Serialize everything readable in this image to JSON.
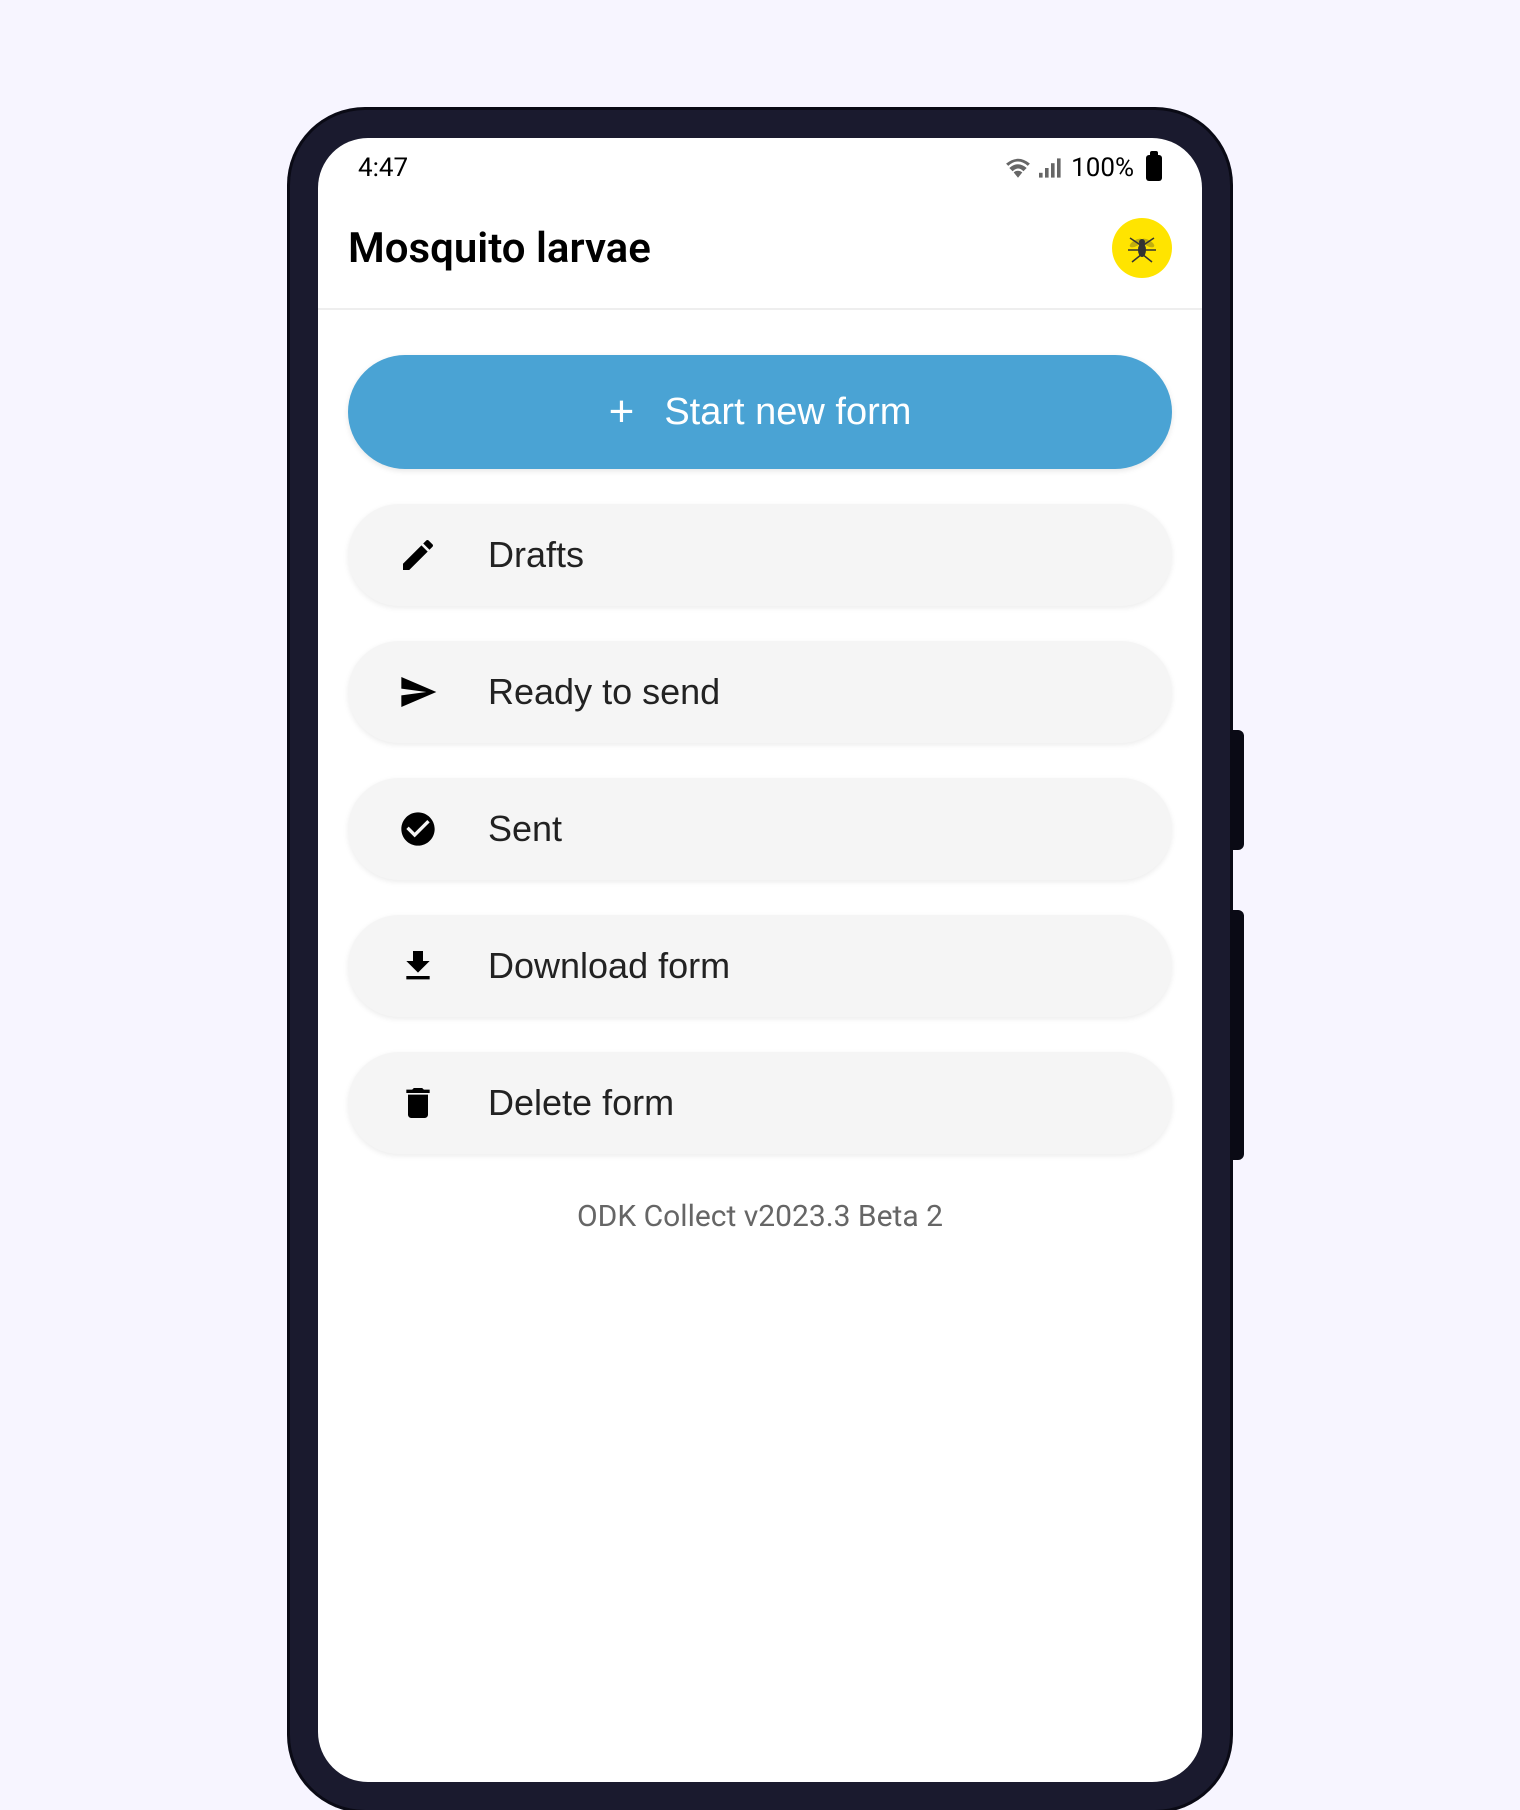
{
  "status_bar": {
    "time": "4:47",
    "battery_percent": "100%"
  },
  "header": {
    "title": "Mosquito larvae",
    "profile_icon": "mosquito-icon"
  },
  "primary_action": {
    "label": "Start new form"
  },
  "menu": {
    "items": [
      {
        "icon": "edit-icon",
        "label": "Drafts"
      },
      {
        "icon": "send-icon",
        "label": "Ready to send"
      },
      {
        "icon": "check-circle-icon",
        "label": "Sent"
      },
      {
        "icon": "download-icon",
        "label": "Download form"
      },
      {
        "icon": "delete-icon",
        "label": "Delete form"
      }
    ]
  },
  "footer": {
    "version": "ODK Collect v2023.3 Beta 2"
  },
  "colors": {
    "primary": "#4aa3d4",
    "accent": "#ffe400",
    "background": "#f7f5ff",
    "button_bg": "#f5f5f5"
  }
}
